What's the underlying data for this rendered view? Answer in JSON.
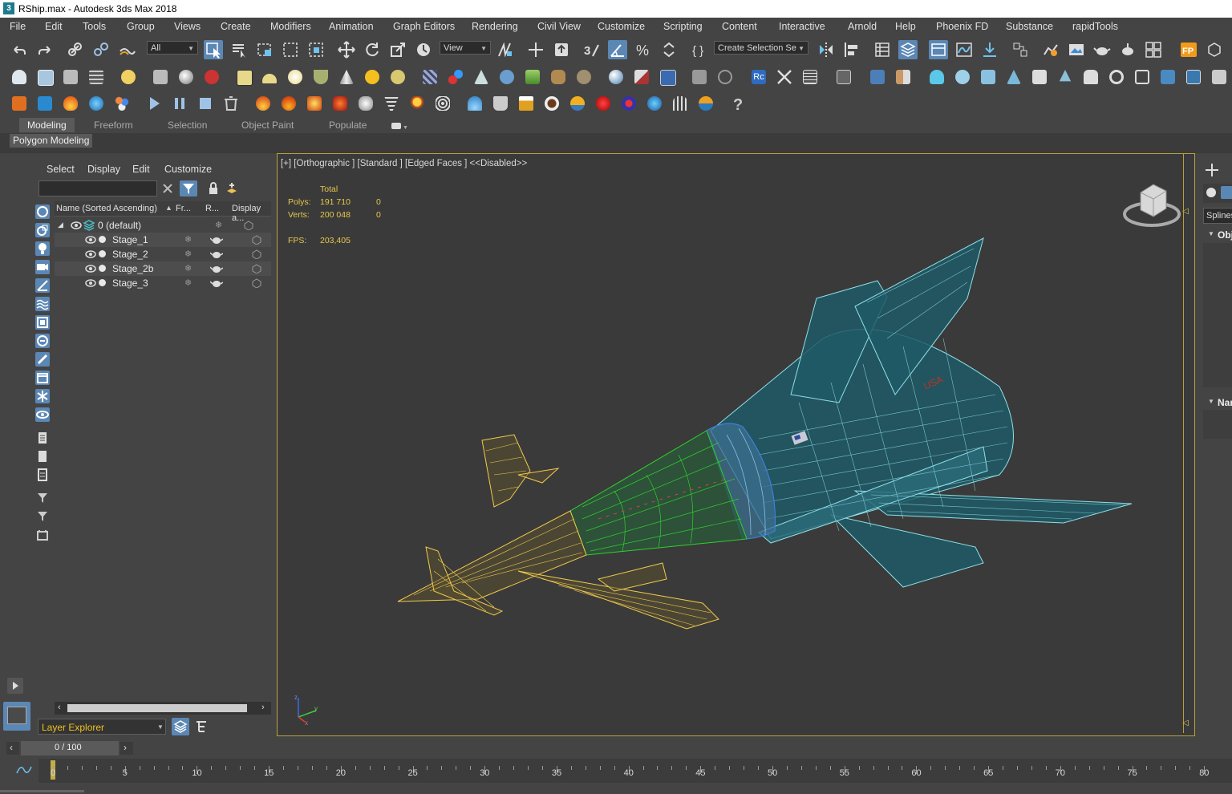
{
  "window": {
    "title": "RShip.max - Autodesk 3ds Max 2018",
    "app_icon_glyph": "3"
  },
  "menu": [
    "File",
    "Edit",
    "Tools",
    "Group",
    "Views",
    "Create",
    "Modifiers",
    "Animation",
    "Graph Editors",
    "Rendering",
    "Civil View",
    "Customize",
    "Scripting",
    "Content",
    "Interactive",
    "Arnold",
    "Help",
    "Phoenix FD",
    "Substance",
    "rapidTools"
  ],
  "toolbar": {
    "filter_value": "All",
    "refcoord_value": "View",
    "selection_set_value": "Create Selection Se"
  },
  "ribbon": {
    "tabs": [
      "Modeling",
      "Freeform",
      "Selection",
      "Object Paint",
      "Populate"
    ],
    "active_tab": "Modeling",
    "panel_label": "Polygon Modeling"
  },
  "explorer": {
    "menu": [
      "Select",
      "Display",
      "Edit",
      "Customize"
    ],
    "search_value": "",
    "columns": [
      "Name (Sorted Ascending)",
      "Fr...",
      "R...",
      "Display a..."
    ],
    "layer": "0 (default)",
    "items": [
      "Stage_1",
      "Stage_2",
      "Stage_2b",
      "Stage_3"
    ],
    "footer_dropdown": "Layer Explorer"
  },
  "viewport": {
    "label": "[+] [Orthographic ] [Standard ] [Edged Faces ]  <<Disabled>>",
    "stats": {
      "header": "Total",
      "polys_label": "Polys:",
      "polys_total": "191 710",
      "polys_sel": "0",
      "verts_label": "Verts:",
      "verts_total": "200 048",
      "verts_sel": "0",
      "fps_label": "FPS:",
      "fps_value": "203,405"
    },
    "model_label": "USA"
  },
  "command_panel": {
    "tab_visible": "Splines",
    "rollout1": "Obj",
    "rollout2": "Nar"
  },
  "timeline": {
    "frame_display": "0 / 100",
    "ticks": [
      "0",
      "5",
      "10",
      "15",
      "20",
      "25",
      "30",
      "35",
      "40",
      "45",
      "50",
      "55",
      "60",
      "65",
      "70",
      "75",
      "80"
    ]
  },
  "colors": {
    "bg": "#444444",
    "viewport_bg": "#3a3a3a",
    "viewport_border": "#b8a03e",
    "stage_yellow": "#f2c94c",
    "stage_green": "#2fd12f",
    "stage_blue": "#3f7fd9",
    "stage_cyan": "#8fe0e8",
    "stats_text": "#e6c84a",
    "select_blue": "#5b87b5"
  }
}
